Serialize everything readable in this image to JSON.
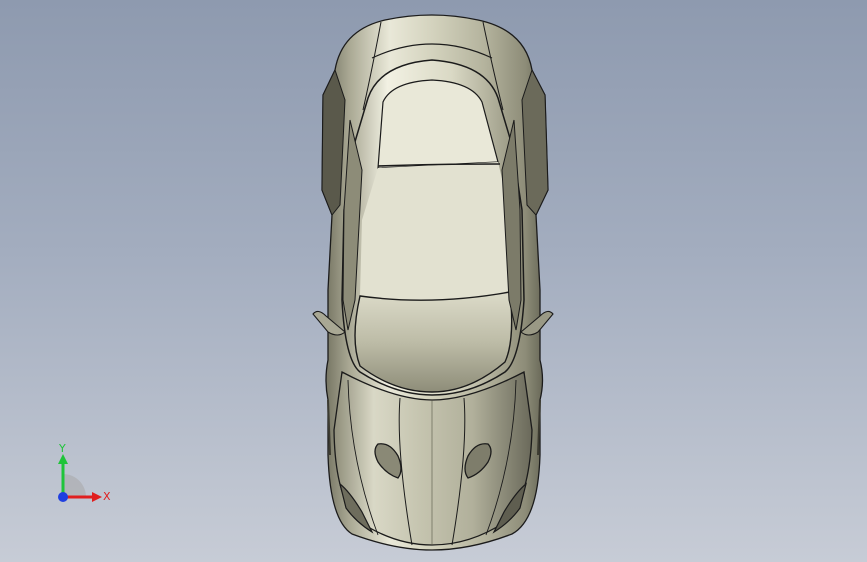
{
  "viewport": {
    "background_top": "#8e9aaf",
    "background_bottom": "#c7ccd6"
  },
  "model": {
    "subject": "car-body-top-view",
    "body_color": "#b9b8a3"
  },
  "triad": {
    "x_label": "X",
    "y_label": "Y",
    "x_color": "#e01f1f",
    "y_color": "#1fc43a",
    "z_color": "#1f3fe0"
  }
}
